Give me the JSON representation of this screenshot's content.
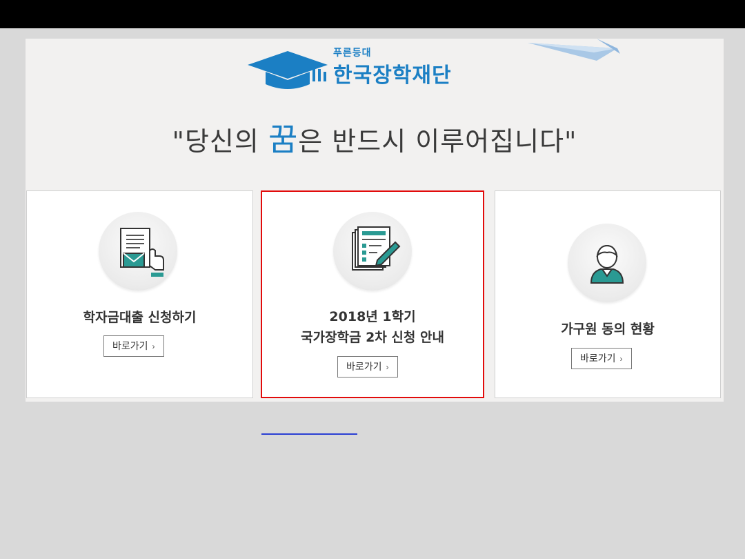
{
  "header": {
    "logo_small": "푸른등대",
    "logo_main": "한국장학재단"
  },
  "slogan": {
    "prefix": "\"당신의 ",
    "dream": "꿈",
    "suffix": "은 반드시 이루어집니다\""
  },
  "cards": [
    {
      "title_lines": [
        "학자금대출 신청하기"
      ],
      "button": "바로가기",
      "icon": "envelope-document-icon"
    },
    {
      "title_lines": [
        "2018년 1학기",
        "국가장학금 2차 신청 안내"
      ],
      "button": "바로가기",
      "icon": "document-pen-icon"
    },
    {
      "title_lines": [
        "가구원 동의 현황"
      ],
      "button": "바로가기",
      "icon": "person-icon"
    }
  ],
  "colors": {
    "brand": "#1b7fc4",
    "highlight_border": "#e20b0b",
    "teal_icon": "#2a9a93"
  }
}
